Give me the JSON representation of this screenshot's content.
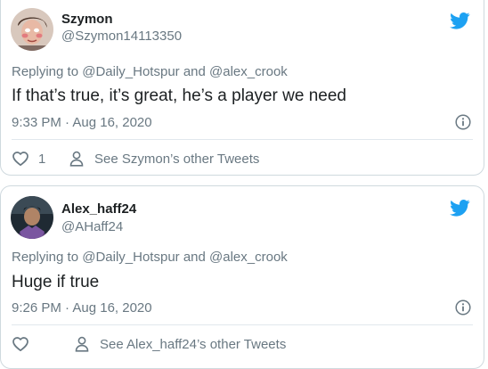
{
  "colors": {
    "twitter_blue": "#1da1f2",
    "text_primary": "#1c2022",
    "text_secondary": "#697882",
    "border": "#cfd9de"
  },
  "tweets": [
    {
      "display_name": "Szymon",
      "handle": "@Szymon14113350",
      "reply_prefix": "Replying to",
      "reply_user_1": "@Daily_Hotspur",
      "reply_conjunction": "and",
      "reply_user_2": "@alex_crook",
      "text": "If that’s true, it’s great, he’s a player we need",
      "timestamp": "9:33 PM · Aug 16, 2020",
      "like_count": "1",
      "profile_link": "See Szymon’s other Tweets",
      "icons": [
        "twitter-bird-icon",
        "info-icon",
        "heart-icon",
        "person-icon"
      ]
    },
    {
      "display_name": "Alex_haff24",
      "handle": "@AHaff24",
      "reply_prefix": "Replying to",
      "reply_user_1": "@Daily_Hotspur",
      "reply_conjunction": "and",
      "reply_user_2": "@alex_crook",
      "text": "Huge if true",
      "timestamp": "9:26 PM · Aug 16, 2020",
      "like_count": "",
      "profile_link": "See Alex_haff24’s other Tweets",
      "icons": [
        "twitter-bird-icon",
        "info-icon",
        "heart-icon",
        "person-icon"
      ]
    }
  ]
}
